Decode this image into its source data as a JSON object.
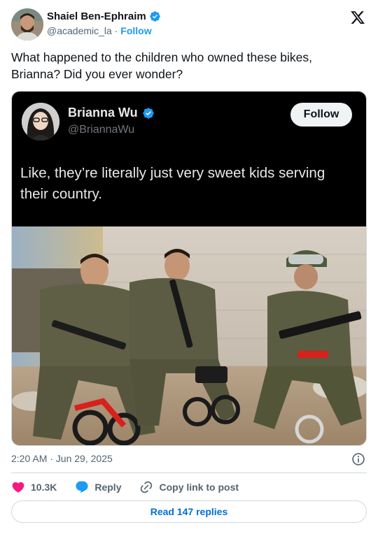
{
  "author": {
    "name": "Shaiel Ben-Ephraim",
    "handle": "@academic_la",
    "separator": "·",
    "follow_label": "Follow"
  },
  "tweet": {
    "text": "What happened to the children who owned these bikes, Brianna? Did you ever wonder?"
  },
  "embedded_post": {
    "name": "Brianna Wu",
    "handle": "@BriannaWu",
    "follow_label": "Follow",
    "text": "Like, they’re literally just very sweet kids serving their country."
  },
  "meta": {
    "timestamp": "2:20 AM · Jun 29, 2025"
  },
  "actions": {
    "like_count": "10.3K",
    "reply_label": "Reply",
    "copy_label": "Copy link to post"
  },
  "read_replies_label": "Read 147 replies",
  "colors": {
    "accent": "#1d9bf0",
    "like": "#f91880",
    "text": "#0f1419",
    "muted": "#536471",
    "border": "#cfd9de"
  },
  "icons": {
    "verified": "verified-badge-icon",
    "logo": "x-logo-icon",
    "info": "info-icon",
    "like": "heart-icon",
    "reply": "reply-bubble-icon",
    "copy": "link-icon"
  }
}
